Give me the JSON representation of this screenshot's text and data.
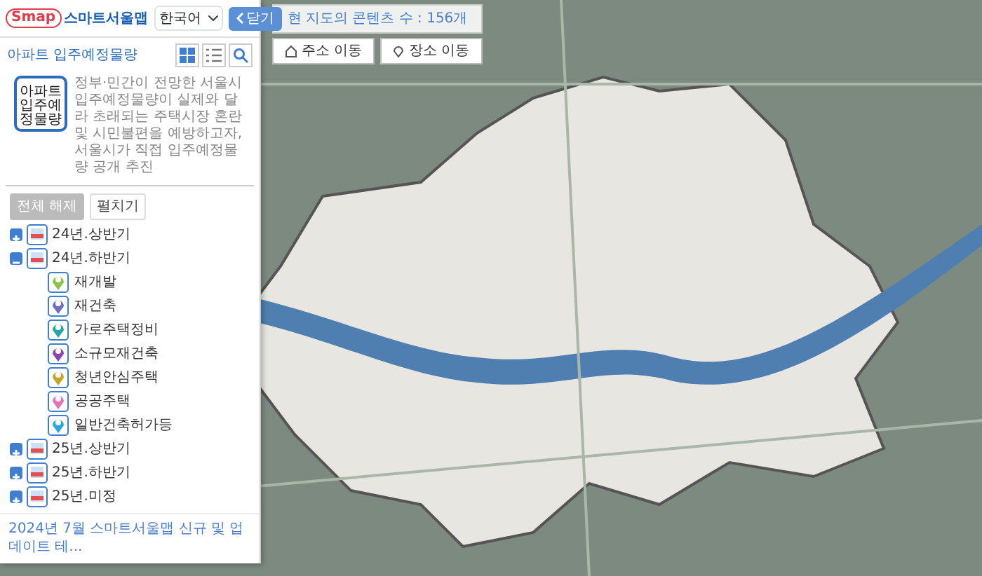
{
  "header": {
    "logo_mark": "Smap",
    "logo_text": "스마트서울맵",
    "language": "한국어",
    "close_button": "닫기"
  },
  "theme": {
    "title": "아파트 입주예정물량",
    "thumb_label": "아파트 입주예정물량",
    "description": "정부·민간이 전망한 서울시 입주예정물량이 실제와 달라 초래되는 주택시장 혼란 및 시민불편을 예방하고자, 서울시가 직접 입주예정물량 공개 추진"
  },
  "tree_buttons": [
    {
      "label": "전체 해제",
      "selected": true
    },
    {
      "label": "펼치기",
      "selected": false
    }
  ],
  "tree": [
    {
      "label": "24년.상반기",
      "expanded": false
    },
    {
      "label": "24년.하반기",
      "expanded": true,
      "children": [
        {
          "label": "재개발",
          "color": "#8bc34a"
        },
        {
          "label": "재건축",
          "color": "#6a6fc0"
        },
        {
          "label": "가로주택정비",
          "color": "#26a6a6"
        },
        {
          "label": "소규모재건축",
          "color": "#8e44ad"
        },
        {
          "label": "청년안심주택",
          "color": "#c9a227"
        },
        {
          "label": "공공주택",
          "color": "#e573b5"
        },
        {
          "label": "일반건축허가등",
          "color": "#29a8e0"
        }
      ]
    },
    {
      "label": "25년.상반기",
      "expanded": false
    },
    {
      "label": "25년.하반기",
      "expanded": false
    },
    {
      "label": "25년.미정",
      "expanded": false
    }
  ],
  "notice": "2024년 7월 스마트서울맵 신규 및 업데이트 테...",
  "map_bar": {
    "content_count": "현 지도의 콘텐츠 수 : 156개",
    "buttons": [
      "주소 이동",
      "장소 이동"
    ]
  }
}
